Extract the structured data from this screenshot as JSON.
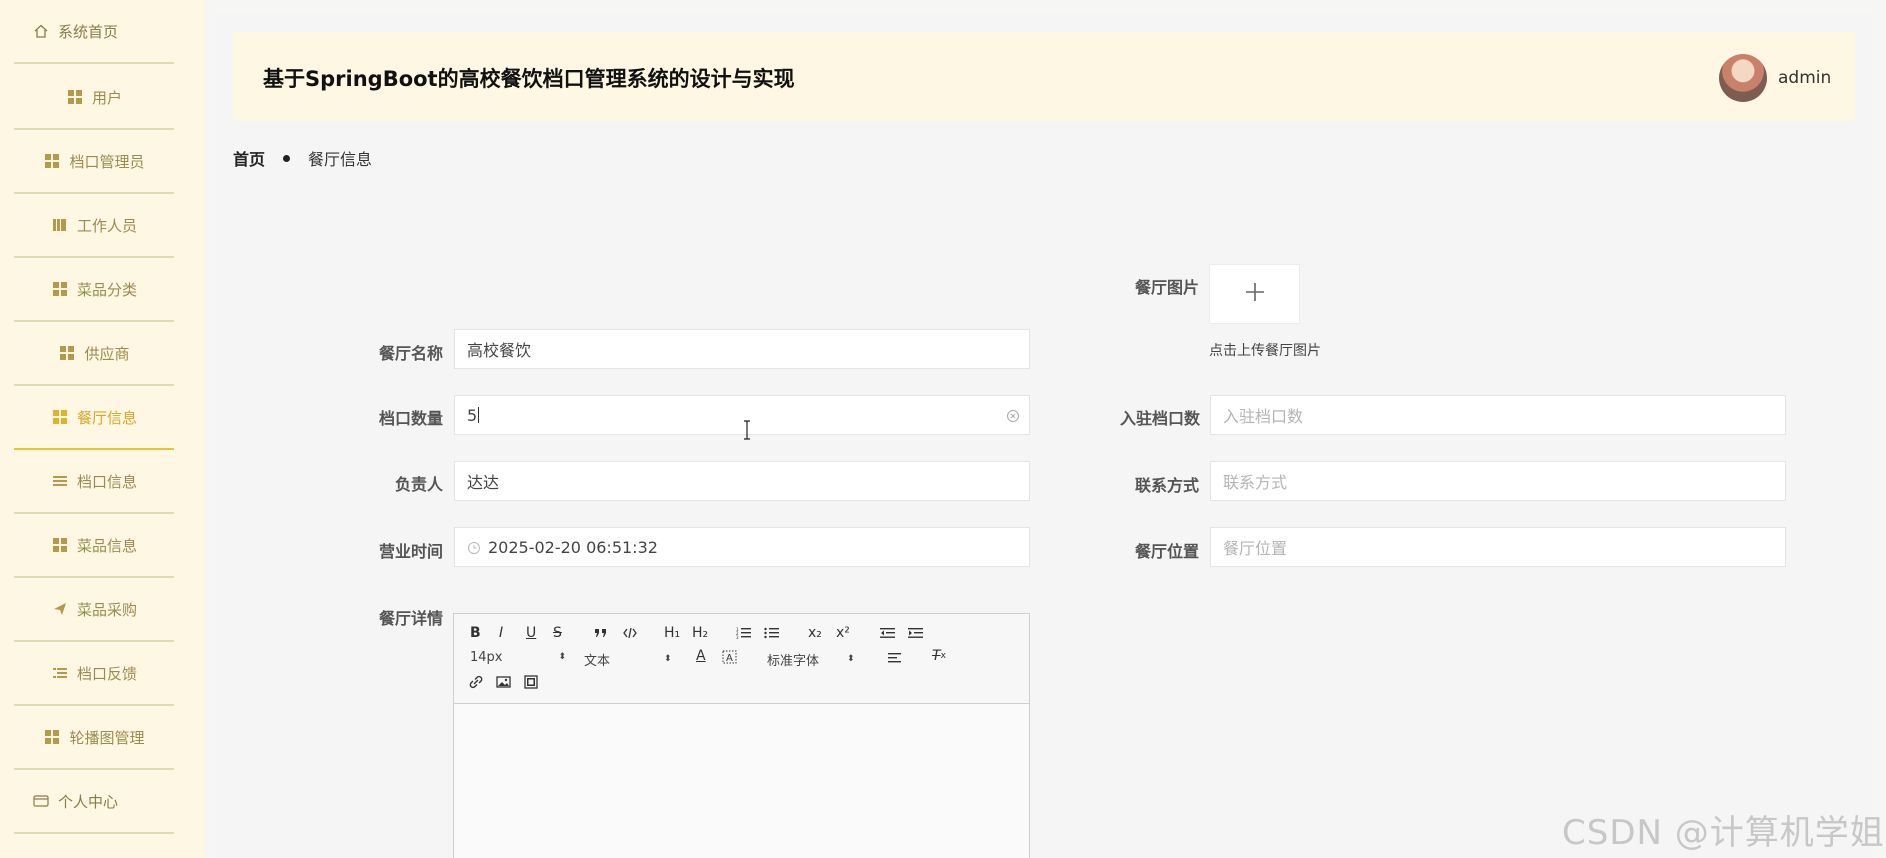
{
  "sidebar": {
    "items": [
      {
        "label": "系统首页",
        "icon": "home-icon"
      },
      {
        "label": "用户",
        "icon": "grid-icon"
      },
      {
        "label": "档口管理员",
        "icon": "grid-icon"
      },
      {
        "label": "工作人员",
        "icon": "book-icon"
      },
      {
        "label": "菜品分类",
        "icon": "grid-icon"
      },
      {
        "label": "供应商",
        "icon": "grid-icon"
      },
      {
        "label": "餐厅信息",
        "icon": "grid-icon",
        "active": true
      },
      {
        "label": "档口信息",
        "icon": "list-icon"
      },
      {
        "label": "菜品信息",
        "icon": "grid-icon"
      },
      {
        "label": "菜品采购",
        "icon": "send-icon"
      },
      {
        "label": "档口反馈",
        "icon": "list-icon"
      },
      {
        "label": "轮播图管理",
        "icon": "grid-icon"
      },
      {
        "label": "个人中心",
        "icon": "card-icon"
      }
    ]
  },
  "header": {
    "title": "基于SpringBoot的高校餐饮档口管理系统的设计与实现",
    "user": "admin"
  },
  "breadcrumb": {
    "home": "首页",
    "current": "餐厅信息"
  },
  "form": {
    "picture_label": "餐厅图片",
    "upload_hint": "点击上传餐厅图片",
    "name_label": "餐厅名称",
    "name_value": "高校餐饮",
    "stall_count_label": "档口数量",
    "stall_count_value": "5",
    "settled_label": "入驻档口数",
    "settled_placeholder": "入驻档口数",
    "manager_label": "负责人",
    "manager_value": "达达",
    "contact_label": "联系方式",
    "contact_placeholder": "联系方式",
    "hours_label": "营业时间",
    "hours_value": "2025-02-20 06:51:32",
    "location_label": "餐厅位置",
    "location_placeholder": "餐厅位置",
    "detail_label": "餐厅详情"
  },
  "editor": {
    "font_size": "14px",
    "block_format": "文本",
    "font_family": "标准字体",
    "buttons": [
      "bold",
      "italic",
      "underline",
      "strike",
      "blockquote",
      "code-block",
      "h1",
      "h2",
      "ordered-list",
      "bullet-list",
      "subscript",
      "superscript",
      "outdent",
      "indent",
      "font-color",
      "background-color",
      "align",
      "clean",
      "link",
      "image",
      "video"
    ],
    "labels": {
      "bold": "B",
      "italic": "I",
      "underline": "U",
      "strike": "S",
      "h1": "H₁",
      "h2": "H₂",
      "sub": "x₂",
      "sup": "x²",
      "color": "A",
      "clean": "T"
    }
  },
  "watermark": "CSDN @计算机学姐"
}
